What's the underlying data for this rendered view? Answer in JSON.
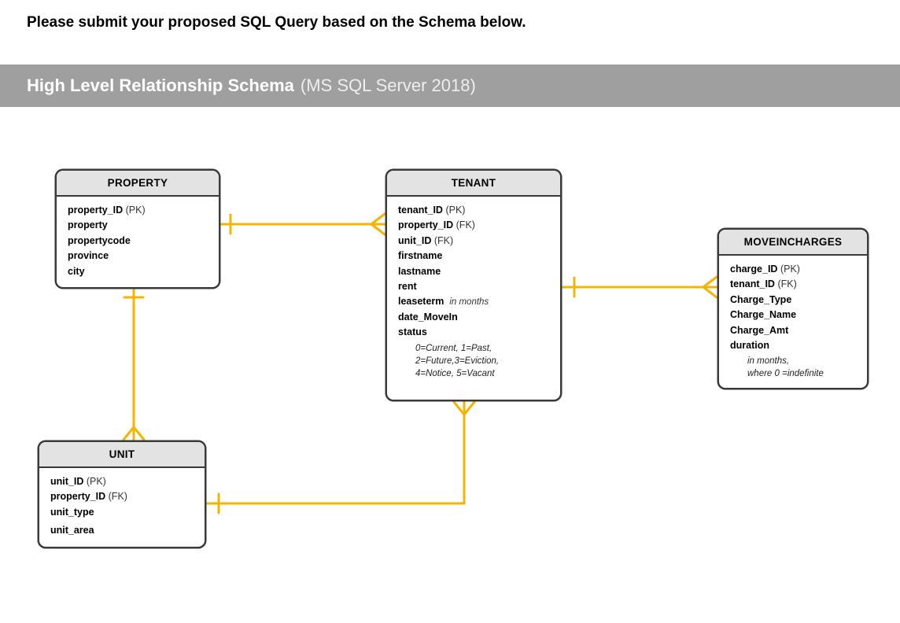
{
  "instruction": "Please submit your proposed SQL Query based on the Schema below.",
  "banner": {
    "strong": "High Level Relationship Schema",
    "light": "(MS SQL Server 2018)"
  },
  "entities": {
    "property": {
      "title": "PROPERTY",
      "fields": {
        "f0": {
          "name": "property_ID",
          "tag": "(PK)"
        },
        "f1": {
          "name": "property"
        },
        "f2": {
          "name": "propertycode"
        },
        "f3": {
          "name": "province"
        },
        "f4": {
          "name": "city"
        }
      }
    },
    "tenant": {
      "title": "TENANT",
      "fields": {
        "f0": {
          "name": "tenant_ID",
          "tag": "(PK)"
        },
        "f1": {
          "name": "property_ID",
          "tag": "(FK)"
        },
        "f2": {
          "name": "unit_ID",
          "tag": "(FK)"
        },
        "f3": {
          "name": "firstname"
        },
        "f4": {
          "name": "lastname"
        },
        "f5": {
          "name": "rent"
        },
        "f6": {
          "name": "leaseterm",
          "note": "in months"
        },
        "f7": {
          "name": "date_MoveIn"
        },
        "f8": {
          "name": "status"
        }
      },
      "status_note_l1": "0=Current, 1=Past,",
      "status_note_l2": "2=Future,3=Eviction,",
      "status_note_l3": "4=Notice, 5=Vacant"
    },
    "moveincharges": {
      "title": "MOVEINCHARGES",
      "fields": {
        "f0": {
          "name": "charge_ID",
          "tag": "(PK)"
        },
        "f1": {
          "name": "tenant_ID",
          "tag": "(FK)"
        },
        "f2": {
          "name": "Charge_Type"
        },
        "f3": {
          "name": "Charge_Name"
        },
        "f4": {
          "name": "Charge_Amt"
        },
        "f5": {
          "name": "duration"
        }
      },
      "note_l1": "in months,",
      "note_l2": "where 0 =indefinite"
    },
    "unit": {
      "title": "UNIT",
      "fields": {
        "f0": {
          "name": "unit_ID",
          "tag": "(PK)"
        },
        "f1": {
          "name": "property_ID",
          "tag": "(FK)"
        },
        "f2": {
          "name": "unit_type"
        },
        "f3": {
          "name": "unit_area"
        }
      }
    }
  },
  "relationships": [
    {
      "from": "PROPERTY",
      "to": "TENANT",
      "type": "one-to-many"
    },
    {
      "from": "PROPERTY",
      "to": "UNIT",
      "type": "one-to-many"
    },
    {
      "from": "UNIT",
      "to": "TENANT",
      "type": "one-to-many"
    },
    {
      "from": "TENANT",
      "to": "MOVEINCHARGES",
      "type": "one-to-many"
    }
  ]
}
